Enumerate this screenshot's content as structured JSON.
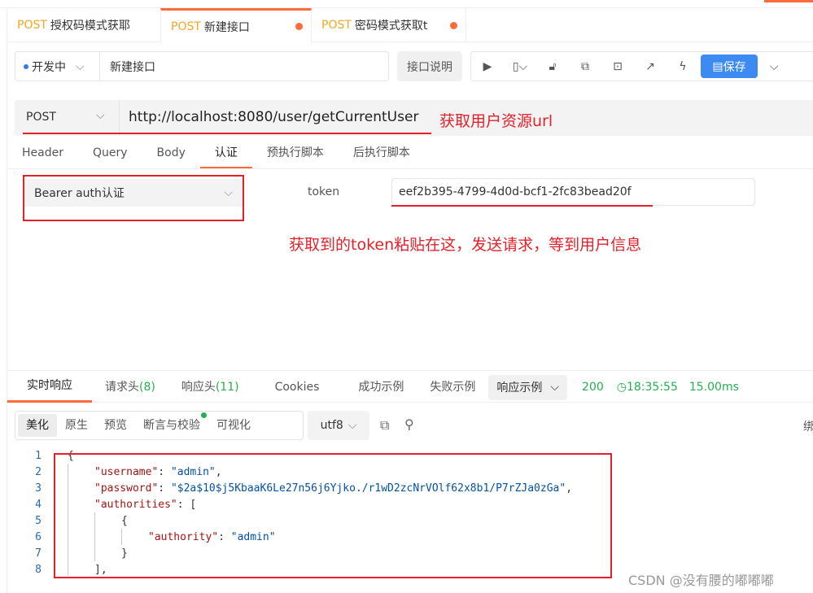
{
  "tabs": [
    {
      "method": "POST",
      "title": "授权码模式获耶"
    },
    {
      "method": "POST",
      "title": "新建接口"
    },
    {
      "method": "POST",
      "title": "密码模式获取t"
    }
  ],
  "status": {
    "label": "开发中",
    "name": "新建接口"
  },
  "doc_button": "接口说明",
  "save_button": "保存",
  "request": {
    "method": "POST",
    "url": "http://localhost:8080/user/getCurrentUser"
  },
  "annotations": {
    "url": "获取用户资源url",
    "token": "获取到的token粘贴在这，发送请求，等到用户信息"
  },
  "req_tabs": [
    "Header",
    "Query",
    "Body",
    "认证",
    "预执行脚本",
    "后执行脚本"
  ],
  "auth": {
    "type": "Bearer auth认证",
    "token_label": "token",
    "token_value": "eef2b395-4799-4d0d-bcf1-2fc83bead20f"
  },
  "resp_tabs": {
    "live": "实时响应",
    "req_headers": "请求头",
    "req_count": "(8)",
    "resp_headers": "响应头",
    "resp_count": "(11)",
    "cookies": "Cookies",
    "success": "成功示例",
    "fail": "失败示例",
    "example": "响应示例"
  },
  "resp_status": {
    "code": "200",
    "time": "18:35:55",
    "duration": "15.00ms"
  },
  "format": [
    "美化",
    "原生",
    "预览",
    "断言与校验",
    "可视化"
  ],
  "encoding": "utf8",
  "right_cut": "绑",
  "code_lines": [
    "1",
    "2",
    "3",
    "4",
    "5",
    "6",
    "7",
    "8"
  ],
  "json": {
    "username_key": "\"username\"",
    "username_val": "\"admin\"",
    "password_key": "\"password\"",
    "password_val": "\"$2a$10$j5KbaaK6Le27n56j6Yjko./r1wD2zcNrVOlf62x8b1/P7rZJa0zGa\"",
    "authorities_key": "\"authorities\"",
    "authority_key": "\"authority\"",
    "authority_val": "\"admin\""
  },
  "watermark": "CSDN @没有腰的嘟嘟嘟"
}
